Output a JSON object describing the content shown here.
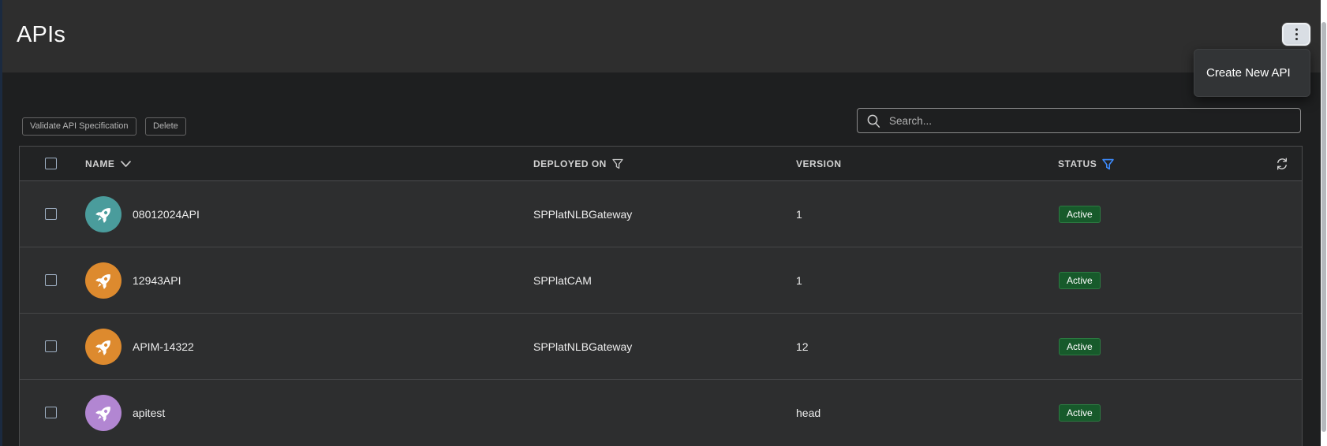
{
  "header": {
    "title": "APIs"
  },
  "kebab_menu": {
    "icon": "kebab-vertical-dots-icon",
    "items": [
      {
        "label": "Create New API"
      }
    ]
  },
  "toolbar": {
    "buttons": [
      {
        "label": "Validate API Specification"
      },
      {
        "label": "Delete"
      }
    ]
  },
  "search": {
    "placeholder": "Search...",
    "icon": "search-icon"
  },
  "table": {
    "columns": [
      {
        "label": "NAME",
        "icon": "chevron-down-icon"
      },
      {
        "label": "DEPLOYED ON",
        "icon": "filter-icon"
      },
      {
        "label": "VERSION",
        "icon": null
      },
      {
        "label": "STATUS",
        "icon": "filter-icon-active"
      }
    ],
    "header_icons": {
      "refresh": "refresh-icon"
    },
    "rows": [
      {
        "name": "08012024API",
        "deployed_on": "SPPlatNLBGateway",
        "version": "1",
        "status": "Active",
        "avatar_color": "#4a9c9c",
        "avatar_icon": "rocket-icon"
      },
      {
        "name": "12943API",
        "deployed_on": "SPPlatCAM",
        "version": "1",
        "status": "Active",
        "avatar_color": "#dd8a2e",
        "avatar_icon": "rocket-icon"
      },
      {
        "name": "APIM-14322",
        "deployed_on": "SPPlatNLBGateway",
        "version": "12",
        "status": "Active",
        "avatar_color": "#dd8a2e",
        "avatar_icon": "rocket-icon"
      },
      {
        "name": "apitest",
        "deployed_on": "",
        "version": "head",
        "status": "Active",
        "avatar_color": "#b286d2",
        "avatar_icon": "rocket-icon"
      }
    ]
  },
  "colors": {
    "left_accent": "#1b2a40",
    "header_band": "#2e2e2e",
    "page_bg": "#1e1f20",
    "row_bg": "#2d2e2f",
    "status_badge_bg": "#175a2b",
    "status_badge_border": "#2d7a42",
    "active_filter_blue": "#3d8bfd"
  }
}
